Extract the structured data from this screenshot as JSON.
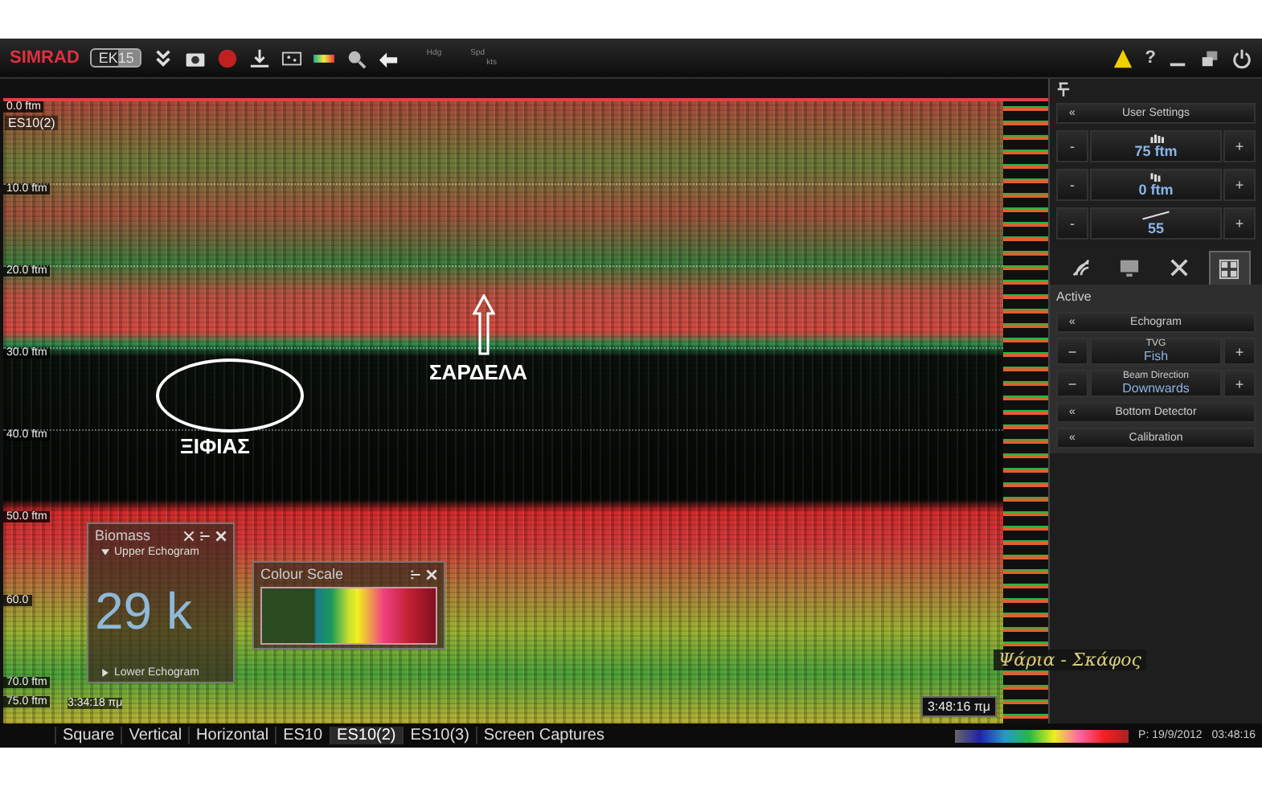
{
  "toolbar": {
    "brand": "SIMRAD",
    "model": "EK15",
    "hdg_label": "Hdg",
    "spd_label": "Spd",
    "spd_unit": "kts",
    "help": "?"
  },
  "echogram": {
    "channel": "ES10(2)",
    "depth_labels": [
      "0.0 ftm",
      "10.0 ftm",
      "20.0 ftm",
      "30.0 ftm",
      "40.0 ftm",
      "50.0 ftm",
      "60.0",
      "70.0 ftm",
      "75.0 ftm"
    ],
    "start_time": "3:34:18 πμ",
    "end_time": "3:48:16 πμ",
    "annotations": [
      {
        "kind": "arrow",
        "text": "ΣΑΡΔΕΛΑ"
      },
      {
        "kind": "ellipse",
        "text": "ΞΙΦΙΑΣ"
      },
      {
        "kind": "handwritten",
        "text": "Ψάρια - Σκάφος"
      }
    ]
  },
  "biomass_panel": {
    "title": "Biomass",
    "upper": {
      "label": "Upper Echogram",
      "expanded": true
    },
    "value": "29 k",
    "lower": {
      "label": "Lower Echogram",
      "expanded": false
    }
  },
  "colour_scale_panel": {
    "title": "Colour Scale"
  },
  "side_panel": {
    "header": {
      "glyph": "«",
      "label": "User Settings"
    },
    "steppers": [
      {
        "kind": "range",
        "minus": "-",
        "value": "75 ftm",
        "plus": "+"
      },
      {
        "kind": "start",
        "minus": "-",
        "value": "0 ftm",
        "plus": "+"
      },
      {
        "kind": "gain",
        "minus": "-",
        "value": "55",
        "plus": "+"
      }
    ],
    "tabs": [
      {
        "kind": "transducer",
        "selected": false
      },
      {
        "kind": "display",
        "selected": false
      },
      {
        "kind": "tools",
        "selected": false
      },
      {
        "kind": "layout",
        "selected": true
      }
    ],
    "section": "Active",
    "items": [
      {
        "kind": "header",
        "glyph": "«",
        "label": "Echogram"
      },
      {
        "kind": "stepper",
        "minus": "−",
        "label": "TVG",
        "value": "Fish",
        "plus": "+"
      },
      {
        "kind": "stepper",
        "minus": "−",
        "label": "Beam Direction",
        "value": "Downwards",
        "plus": "+"
      },
      {
        "kind": "header",
        "glyph": "«",
        "label": "Bottom Detector"
      },
      {
        "kind": "header",
        "glyph": "«",
        "label": "Calibration"
      }
    ]
  },
  "bottom_tabs": [
    {
      "label": "Square",
      "selected": false
    },
    {
      "label": "Vertical",
      "selected": false
    },
    {
      "label": "Horizontal",
      "selected": false
    },
    {
      "label": "ES10",
      "selected": false
    },
    {
      "label": "ES10(2)",
      "selected": true
    },
    {
      "label": "ES10(3)",
      "selected": false
    },
    {
      "label": "Screen Captures",
      "selected": false
    }
  ],
  "status": {
    "date": "P: 19/9/2012",
    "time": "03:48:16"
  }
}
